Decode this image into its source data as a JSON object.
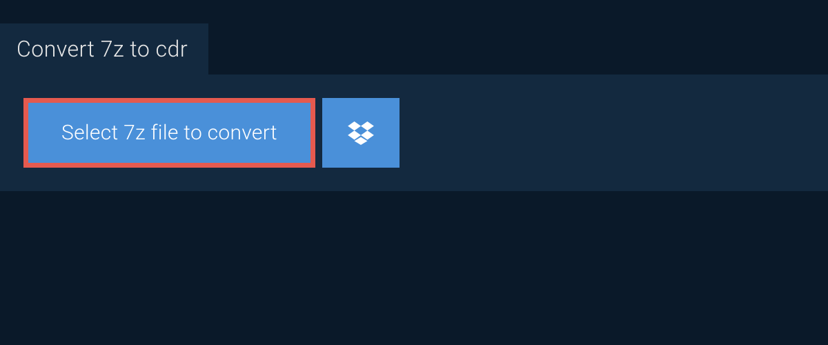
{
  "tab": {
    "label": "Convert 7z to cdr"
  },
  "actions": {
    "select_file_label": "Select 7z file to convert"
  },
  "colors": {
    "background": "#0a1929",
    "panel": "#13293f",
    "button": "#4a90d9",
    "highlight_border": "#e55a4f",
    "text_light": "#e8e8e8",
    "text_white": "#ffffff"
  }
}
